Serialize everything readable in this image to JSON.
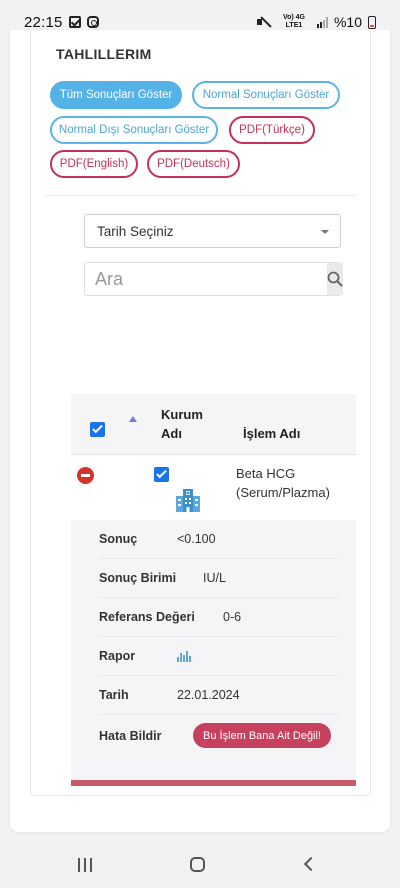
{
  "status_bar": {
    "time": "22:15",
    "network": "Vo) 4G LTE1",
    "battery": "%10"
  },
  "section": {
    "title": "TAHLILLERIM"
  },
  "filters": [
    {
      "label": "Tüm Sonuçları Göster",
      "state": "active"
    },
    {
      "label": "Normal Sonuçları Göster",
      "state": "outline-blue"
    },
    {
      "label": "Normal Dışı Sonuçları Göster",
      "state": "outline-blue"
    },
    {
      "label": "PDF(Türkçe)",
      "state": "outline-red"
    },
    {
      "label": "PDF(English)",
      "state": "outline-red"
    },
    {
      "label": "PDF(Deutsch)",
      "state": "outline-red"
    }
  ],
  "date_select": {
    "value": "Tarih Seçiniz"
  },
  "search": {
    "placeholder": "Ara"
  },
  "table": {
    "header": {
      "institution_col": "Kurum Adı",
      "operation_col": "İşlem Adı"
    },
    "row": {
      "operation_name": "Beta HCG (Serum/Plazma)",
      "details": [
        {
          "label": "Sonuç",
          "value": "<0.100"
        },
        {
          "label": "Sonuç Birimi",
          "value": "IU/L"
        },
        {
          "label": "Referans Değeri",
          "value": "0-6"
        },
        {
          "label": "Rapor",
          "value": ""
        },
        {
          "label": "Tarih",
          "value": "22.01.2024"
        },
        {
          "label": "Hata Bildir",
          "value": "Bu İşlem Bana Ait Değil!"
        }
      ]
    }
  },
  "colors": {
    "accent_blue": "#54b2e7",
    "accent_red": "#c23157",
    "checkbox_blue": "#1a73e8",
    "error_button": "#c5415d"
  }
}
